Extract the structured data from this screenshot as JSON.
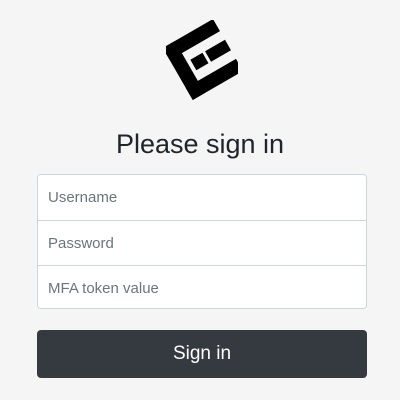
{
  "logo": {
    "icon": "brand-logo-icon",
    "color": "#000000"
  },
  "heading": "Please sign in",
  "form": {
    "username_placeholder": "Username",
    "password_placeholder": "Password",
    "mfa_placeholder": "MFA token value"
  },
  "submit_label": "Sign in",
  "colors": {
    "background": "#f5f5f5",
    "button": "#343a40",
    "button_text": "#ffffff",
    "border": "#ced4da"
  }
}
